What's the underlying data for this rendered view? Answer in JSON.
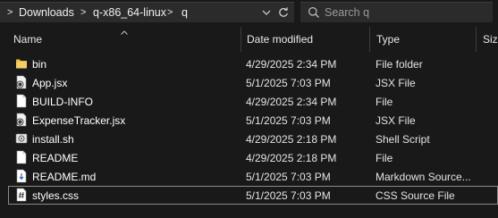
{
  "address": {
    "crumbs": [
      "Downloads",
      "q-x86_64-linux",
      "q"
    ],
    "separator": ">"
  },
  "search": {
    "placeholder": "Search q"
  },
  "columns": {
    "name": "Name",
    "date": "Date modified",
    "type": "Type",
    "size": "Size"
  },
  "files": [
    {
      "name": "bin",
      "date": "4/29/2025 2:34 PM",
      "type": "File folder",
      "icon": "folder-icon"
    },
    {
      "name": "App.jsx",
      "date": "5/1/2025 7:03 PM",
      "type": "JSX File",
      "icon": "jsx-file-icon"
    },
    {
      "name": "BUILD-INFO",
      "date": "4/29/2025 2:34 PM",
      "type": "File",
      "icon": "file-icon"
    },
    {
      "name": "ExpenseTracker.jsx",
      "date": "5/1/2025 7:03 PM",
      "type": "JSX File",
      "icon": "jsx-file-icon"
    },
    {
      "name": "install.sh",
      "date": "4/29/2025 2:18 PM",
      "type": "Shell Script",
      "icon": "script-file-icon"
    },
    {
      "name": "README",
      "date": "4/29/2025 2:18 PM",
      "type": "File",
      "icon": "file-icon"
    },
    {
      "name": "README.md",
      "date": "5/1/2025 7:03 PM",
      "type": "Markdown Source...",
      "icon": "markdown-file-icon"
    },
    {
      "name": "styles.css",
      "date": "5/1/2025 7:03 PM",
      "type": "CSS Source File",
      "icon": "css-file-icon",
      "selected": true
    }
  ]
}
